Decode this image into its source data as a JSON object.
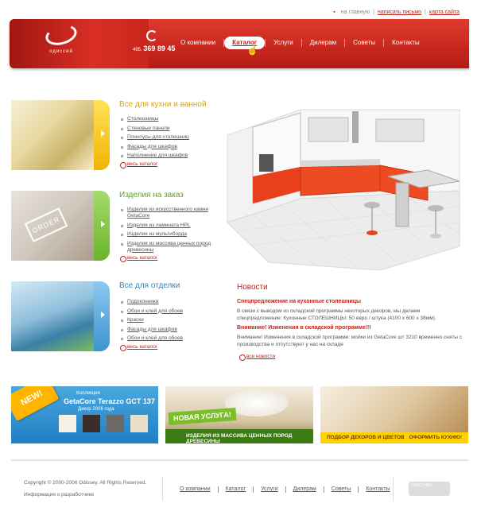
{
  "top_links": [
    "на главную",
    "написать письмо",
    "карта сайта"
  ],
  "header": {
    "logo_text": "одиссей",
    "phone_code": "495",
    "phone_number": "369 89 45",
    "nav": [
      "О компании",
      "Каталог",
      "Услуги",
      "Дилерам",
      "Советы",
      "Контакты"
    ],
    "active_nav": "Каталог"
  },
  "sections": [
    {
      "title": "Все для кухни и ванной",
      "items": [
        "Столешницы",
        "Стеновые панели",
        "Плинтусы для столешниц",
        "Фасады для шкафов",
        "Наполнение для шкафов"
      ],
      "all_link": "весь каталог"
    },
    {
      "title": "Изделия на заказ",
      "items": [
        "Изделия из искусственного камня GetaCore",
        "Изделия из ламината HPL",
        "Изделия из мультиборда",
        "Изделия из массива ценных пород древесины"
      ],
      "all_link": "весь каталог",
      "stamp": "ORDER"
    },
    {
      "title": "Все для отделки",
      "items": [
        "Подоконники",
        "Обои и клей для обоев",
        "Краски",
        "Фасады для шкафов",
        "Обои и клей для обоев"
      ],
      "all_link": "весь каталог"
    }
  ],
  "news": {
    "title": "Новости",
    "items": [
      {
        "headline": "Спецпредложение на кухонные столешницы",
        "text": "В связи с выводом из складской программы некоторых декоров, мы делаем спецпредложение: Кухонные СТОЛЕШНИЦЫ: 50 евро / штука (4100 x 600 x 38мм)."
      },
      {
        "headline": "Внимание! Изменения в складской программе!!!",
        "text": "Внимание! Изменения в складской программе: мойки из GetaCore шт 3210 временно сняты с производства и отсутствуют у нас на складе"
      }
    ],
    "all_link": "все новости"
  },
  "banners": {
    "b1": {
      "tag": "NEW!",
      "collection": "Коллекция",
      "name": "GetaCore Terazzo GCT 137",
      "decor": "Декор 2006 года"
    },
    "b2": {
      "chip": "НОВАЯ УСЛУГА!",
      "bar": "ИЗДЕЛИЯ ИЗ МАССИВА ЦЕННЫХ ПОРОД ДРЕВЕСИНЫ"
    },
    "b3": {
      "left": "ПОДБОР ДЕКОРОВ И ЦВЕТОВ",
      "right": "ОФОРМИТЬ КУХНЮ!"
    }
  },
  "footer": {
    "copyright": "Copyright © 2000-2006 Odissey. All Rights Reserved.",
    "developer": "Информация о разработчике",
    "nav": [
      "О компании",
      "Каталог",
      "Услуги",
      "Дилерам",
      "Советы",
      "Контакты"
    ],
    "counter_label": "УЧАСТНИК"
  },
  "colors": {
    "brand_red": "#c0221a",
    "yellow": "#f1b400",
    "green": "#6bb52a",
    "blue": "#3d94cf"
  }
}
